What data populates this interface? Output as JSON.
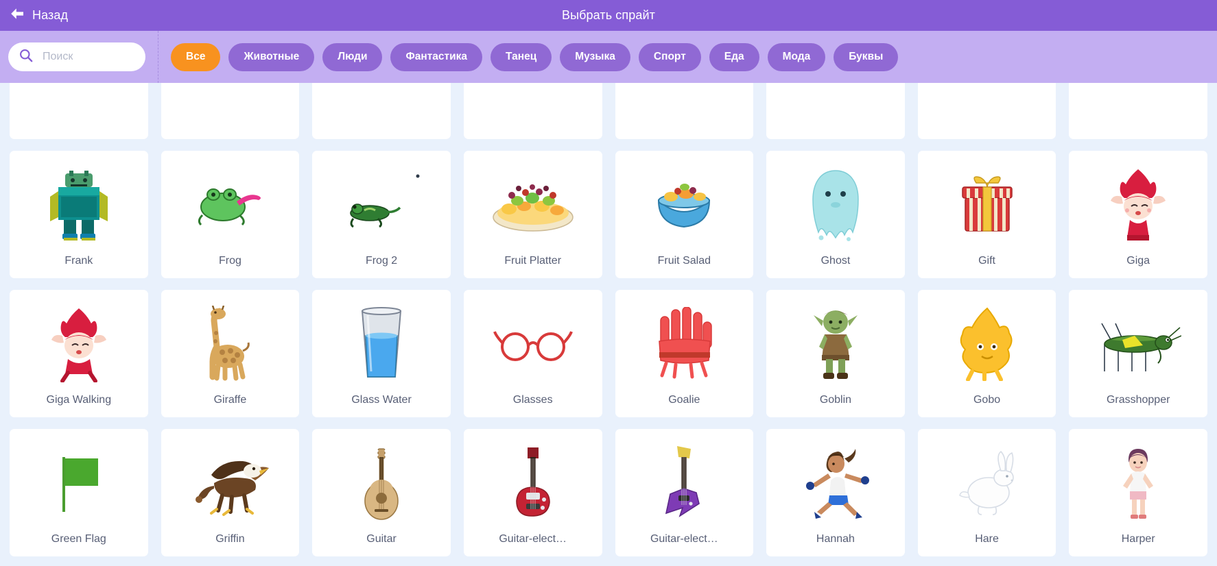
{
  "header": {
    "back_label": "Назад",
    "title": "Выбрать спрайт",
    "back_icon": "arrow-left-icon",
    "bar_color": "#855cd6"
  },
  "filter_bar": {
    "bar_color": "#c3aef2",
    "search": {
      "icon": "search-icon",
      "placeholder": "Поиск",
      "value": ""
    },
    "active_tag": "Все",
    "active_color": "#f8921f",
    "tag_color": "#9069d4",
    "tags": [
      {
        "label": "Все",
        "active": true
      },
      {
        "label": "Животные",
        "active": false
      },
      {
        "label": "Люди",
        "active": false
      },
      {
        "label": "Фантастика",
        "active": false
      },
      {
        "label": "Танец",
        "active": false
      },
      {
        "label": "Музыка",
        "active": false
      },
      {
        "label": "Спорт",
        "active": false
      },
      {
        "label": "Еда",
        "active": false
      },
      {
        "label": "Мода",
        "active": false
      },
      {
        "label": "Буквы",
        "active": false
      }
    ]
  },
  "library": {
    "background": "#e9f1fc",
    "card_background": "#ffffff",
    "label_color": "#575e75",
    "rows": [
      {
        "clipped": true,
        "items": [
          {
            "name": "",
            "icon": "sprite-thumb-partial"
          },
          {
            "name": "",
            "icon": "sprite-thumb-partial"
          },
          {
            "name": "",
            "icon": "sprite-thumb-partial"
          },
          {
            "name": "",
            "icon": "sprite-thumb-partial"
          },
          {
            "name": "",
            "icon": "sprite-thumb-partial"
          },
          {
            "name": "",
            "icon": "sprite-thumb-partial"
          },
          {
            "name": "",
            "icon": "sprite-thumb-partial"
          },
          {
            "name": "",
            "icon": "sprite-thumb-partial"
          }
        ]
      },
      {
        "clipped": false,
        "items": [
          {
            "name": "Frank",
            "icon": "frank-sprite-icon"
          },
          {
            "name": "Frog",
            "icon": "frog-sprite-icon"
          },
          {
            "name": "Frog 2",
            "icon": "frog2-sprite-icon"
          },
          {
            "name": "Fruit Platter",
            "icon": "fruit-platter-sprite-icon"
          },
          {
            "name": "Fruit Salad",
            "icon": "fruit-salad-sprite-icon"
          },
          {
            "name": "Ghost",
            "icon": "ghost-sprite-icon"
          },
          {
            "name": "Gift",
            "icon": "gift-sprite-icon"
          },
          {
            "name": "Giga",
            "icon": "giga-sprite-icon"
          }
        ]
      },
      {
        "clipped": false,
        "items": [
          {
            "name": "Giga Walking",
            "icon": "giga-walking-sprite-icon"
          },
          {
            "name": "Giraffe",
            "icon": "giraffe-sprite-icon"
          },
          {
            "name": "Glass Water",
            "icon": "glass-water-sprite-icon"
          },
          {
            "name": "Glasses",
            "icon": "glasses-sprite-icon"
          },
          {
            "name": "Goalie",
            "icon": "goalie-sprite-icon"
          },
          {
            "name": "Goblin",
            "icon": "goblin-sprite-icon"
          },
          {
            "name": "Gobo",
            "icon": "gobo-sprite-icon"
          },
          {
            "name": "Grasshopper",
            "icon": "grasshopper-sprite-icon"
          }
        ]
      },
      {
        "clipped": false,
        "items": [
          {
            "name": "Green Flag",
            "icon": "green-flag-sprite-icon"
          },
          {
            "name": "Griffin",
            "icon": "griffin-sprite-icon"
          },
          {
            "name": "Guitar",
            "icon": "guitar-sprite-icon"
          },
          {
            "name": "Guitar-elect…",
            "icon": "guitar-electric1-sprite-icon"
          },
          {
            "name": "Guitar-elect…",
            "icon": "guitar-electric2-sprite-icon"
          },
          {
            "name": "Hannah",
            "icon": "hannah-sprite-icon"
          },
          {
            "name": "Hare",
            "icon": "hare-sprite-icon"
          },
          {
            "name": "Harper",
            "icon": "harper-sprite-icon"
          }
        ]
      }
    ]
  }
}
